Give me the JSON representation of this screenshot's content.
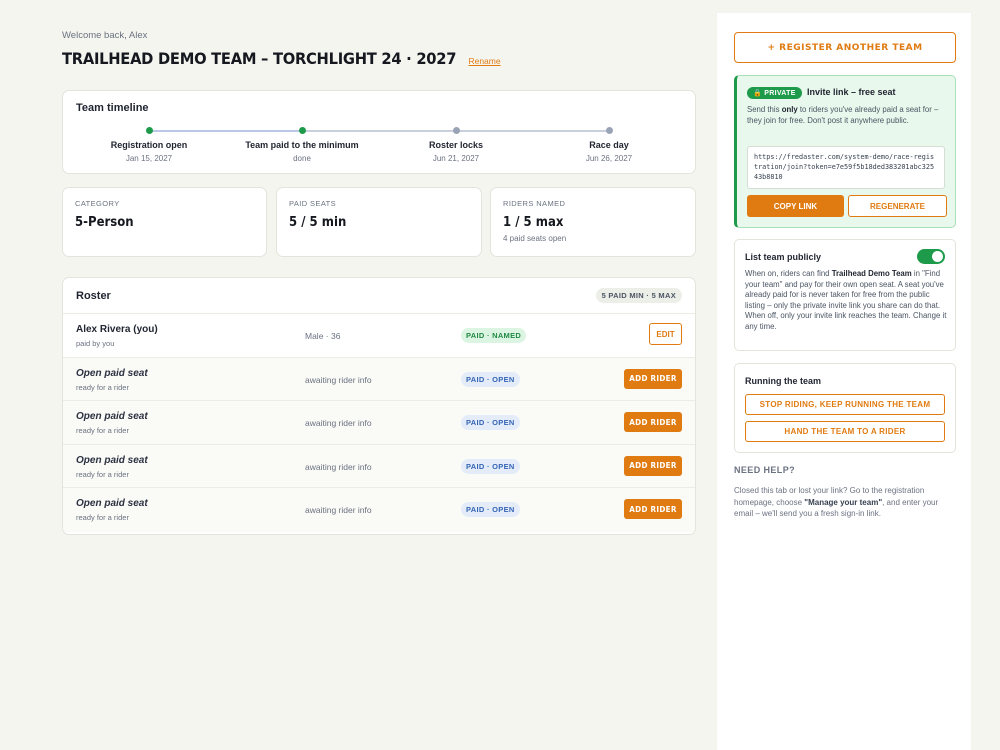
{
  "header": {
    "welcome": "Welcome back, Alex",
    "title": "TRAILHEAD DEMO TEAM – TORCHLIGHT 24 · 2027",
    "rename_label": "Rename"
  },
  "timeline": {
    "title": "Team timeline",
    "steps": [
      {
        "label": "Registration open",
        "sub": "Jan 15, 2027",
        "status": "done"
      },
      {
        "label": "Team paid to the minimum",
        "sub": "done",
        "status": "done"
      },
      {
        "label": "Roster locks",
        "sub": "Jun 21, 2027",
        "status": "upcoming"
      },
      {
        "label": "Race day",
        "sub": "Jun 26, 2027",
        "status": "upcoming"
      }
    ]
  },
  "stats": {
    "category": {
      "label": "CATEGORY",
      "value": "5-Person"
    },
    "paid_seats": {
      "label": "PAID SEATS",
      "value": "5 / 5 min"
    },
    "riders_named": {
      "label": "RIDERS NAMED",
      "value": "1 / 5 max",
      "sub": "4 paid seats open"
    }
  },
  "roster": {
    "title": "Roster",
    "summary_badge": "5 PAID MIN · 5 MAX",
    "rows": [
      {
        "name": "Alex Rivera (you)",
        "sub": "paid by you",
        "info": "Male · 36",
        "badge": "PAID · NAMED",
        "action": "EDIT"
      },
      {
        "name": "Open paid seat",
        "sub": "ready for a rider",
        "info": "awaiting rider info",
        "badge": "PAID · OPEN",
        "action": "ADD RIDER"
      },
      {
        "name": "Open paid seat",
        "sub": "ready for a rider",
        "info": "awaiting rider info",
        "badge": "PAID · OPEN",
        "action": "ADD RIDER"
      },
      {
        "name": "Open paid seat",
        "sub": "ready for a rider",
        "info": "awaiting rider info",
        "badge": "PAID · OPEN",
        "action": "ADD RIDER"
      },
      {
        "name": "Open paid seat",
        "sub": "ready for a rider",
        "info": "awaiting rider info",
        "badge": "PAID · OPEN",
        "action": "ADD RIDER"
      }
    ]
  },
  "sidebar": {
    "register_label": "+ REGISTER ANOTHER TEAM",
    "invite": {
      "badge": "🔒 PRIVATE",
      "title": "Invite link – free seat",
      "desc_before": "Send this ",
      "desc_bold": "only",
      "desc_after": " to riders you've already paid a seat for – they join for free. Don't post it anywhere public.",
      "link": "https://fredaster.com/system-demo/race-registration/join?token=e7e59f5b18ded383201abc32543b8810",
      "copy_label": "COPY LINK",
      "regen_label": "REGENERATE"
    },
    "list_public": {
      "title": "List team publicly",
      "enabled": true,
      "desc_1": "When on, riders can find ",
      "desc_bold": "Trailhead Demo Team",
      "desc_2": " in \"Find your team\" and pay for their own open seat. A seat you've already paid for is never taken for free from the public listing – only the private invite link you share can do that. When off, only your invite link reaches the team. Change it any time."
    },
    "running": {
      "title": "Running the team",
      "btn_1": "STOP RIDING, KEEP RUNNING THE TEAM",
      "btn_2": "HAND THE TEAM TO A RIDER"
    },
    "help": {
      "title": "NEED HELP?",
      "desc_1": "Closed this tab or lost your link? Go to the registration homepage, choose ",
      "desc_bold": "\"Manage your team\"",
      "desc_2": ", and enter your email – we'll send you a fresh sign-in link."
    }
  },
  "colors": {
    "accent": "#e07b12",
    "success": "#1d9a4a",
    "info": "#3565b5",
    "timeline_done": "#1d9a4a",
    "timeline_upcoming": "#9aa3b5"
  }
}
